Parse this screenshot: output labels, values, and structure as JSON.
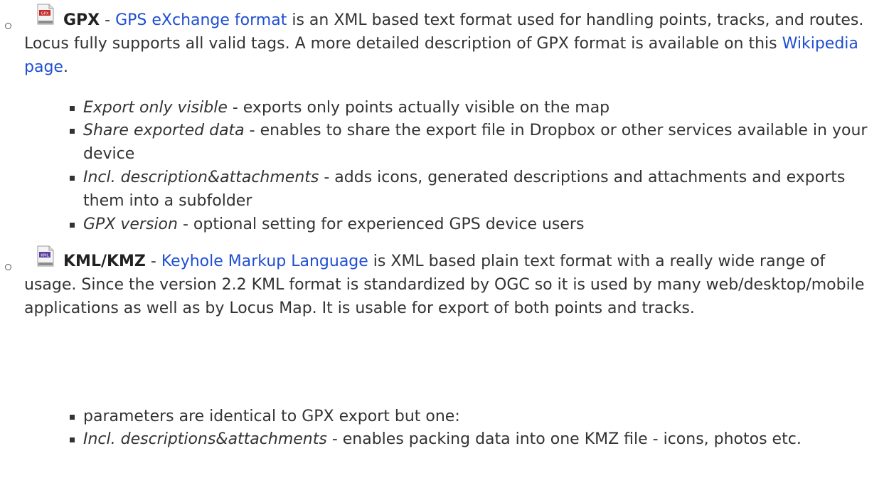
{
  "gpx": {
    "icon_label": "GPX",
    "name": "GPX",
    "sep": " - ",
    "link": "GPS eXchange format",
    "desc": " is an XML based text format used for handling points, tracks, and routes. Locus fully supports all valid tags. A more detailed description of GPX format is available on this ",
    "wiki_link": "Wikipedia page",
    "end": ".",
    "options": [
      {
        "term": "Export only visible",
        "desc": " - exports only points actually visible on the map"
      },
      {
        "term": "Share exported data",
        "desc": " - enables to share the export file in Dropbox or other services available in your device"
      },
      {
        "term": "Incl. description&attachments",
        "desc": " - adds icons, generated descriptions and attachments and exports them into a subfolder"
      },
      {
        "term": "GPX version",
        "desc": " - optional setting for experienced GPS device users"
      }
    ]
  },
  "kml": {
    "icon_label": "KML",
    "name": "KML/KMZ",
    "sep": " - ",
    "link": "Keyhole Markup Language",
    "desc": " is XML based plain text format with a really wide range of usage. Since the version 2.2 KML format is standardized by OGC so it is used by many web/desktop/mobile applications as well as by Locus Map. It is usable for export of both points and tracks.",
    "options": [
      {
        "term": "",
        "desc": "parameters are identical to GPX export but one:"
      },
      {
        "term": "Incl. descriptions&attachments",
        "desc": " - enables packing data into one KMZ file - icons, photos etc."
      }
    ]
  },
  "colors": {
    "link": "#1f4fd1",
    "gpx_icon": "#c62828",
    "kml_icon": "#5c3fa0"
  }
}
